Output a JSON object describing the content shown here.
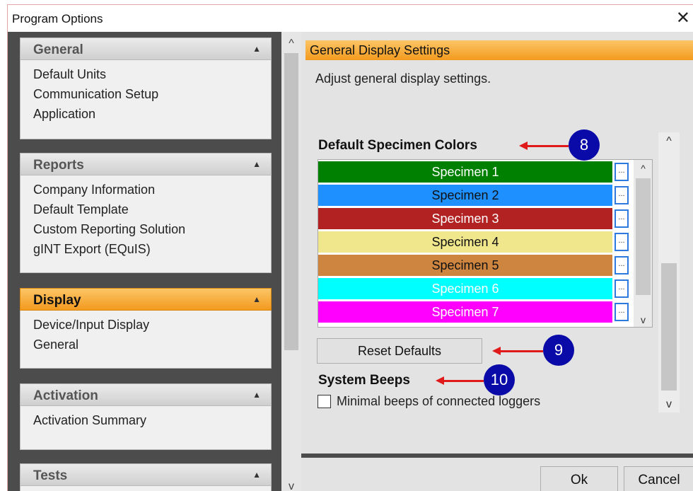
{
  "window": {
    "title": "Program Options",
    "close_glyph": "✕"
  },
  "nav": {
    "groups": [
      {
        "title": "General",
        "items": [
          "Default Units",
          "Communication Setup",
          "Application"
        ]
      },
      {
        "title": "Reports",
        "items": [
          "Company Information",
          "Default Template",
          "Custom Reporting Solution",
          "gINT Export (EQuIS)"
        ]
      },
      {
        "title": "Display",
        "active": true,
        "items": [
          "Device/Input Display",
          "General"
        ]
      },
      {
        "title": "Activation",
        "items": [
          "Activation Summary"
        ]
      },
      {
        "title": "Tests",
        "items": []
      }
    ]
  },
  "content": {
    "section_title": "General Display Settings",
    "description": "Adjust general display settings.",
    "specimen_label": "Default Specimen Colors",
    "specimens": [
      {
        "label": "Specimen 1",
        "color": "#008000",
        "text_color": "#ffffff"
      },
      {
        "label": "Specimen 2",
        "color": "#1e90ff",
        "text_color": "#111111"
      },
      {
        "label": "Specimen 3",
        "color": "#b22222",
        "text_color": "#ffffff"
      },
      {
        "label": "Specimen 4",
        "color": "#f0e68c",
        "text_color": "#111111"
      },
      {
        "label": "Specimen 5",
        "color": "#cd853f",
        "text_color": "#111111"
      },
      {
        "label": "Specimen 6",
        "color": "#00ffff",
        "text_color": "#ffffff"
      },
      {
        "label": "Specimen 7",
        "color": "#ff00ff",
        "text_color": "#ffffff"
      }
    ],
    "color_button_label": "...",
    "reset_label": "Reset Defaults",
    "beeps_label": "System Beeps",
    "beeps_checkbox_label": "Minimal beeps of connected loggers",
    "beeps_checked": false
  },
  "callouts": {
    "c8": "8",
    "c9": "9",
    "c10": "10"
  },
  "footer": {
    "ok_label": "Ok",
    "cancel_label": "Cancel"
  },
  "icons": {
    "collapse": "▲",
    "scroll_up": "^",
    "scroll_down": "v"
  }
}
